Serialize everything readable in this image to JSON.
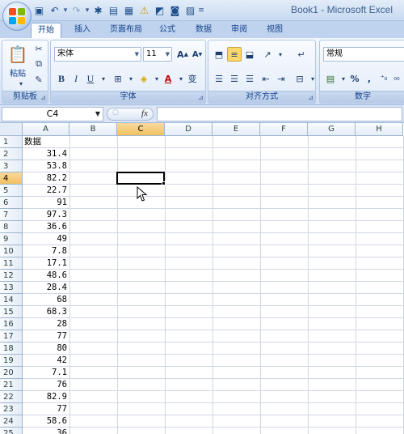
{
  "window": {
    "title": "Book1 - Microsoft Excel"
  },
  "quick_access": [
    "save-icon",
    "undo-icon",
    "redo-icon",
    "tool-icon",
    "form-icon",
    "grid-icon",
    "warning-icon",
    "chart-icon",
    "camera-icon",
    "image-icon"
  ],
  "ribbon_tabs": [
    "开始",
    "插入",
    "页面布局",
    "公式",
    "数据",
    "审阅",
    "视图"
  ],
  "active_tab": 0,
  "groups": {
    "clipboard": {
      "label": "剪贴板",
      "paste_label": "粘贴"
    },
    "font": {
      "label": "字体",
      "font_name": "宋体",
      "font_size": "11",
      "phonetic": "变"
    },
    "alignment": {
      "label": "对齐方式"
    },
    "number": {
      "label": "数字",
      "format": "常规",
      "percent": "%",
      "comma": ","
    }
  },
  "formula_bar": {
    "name_box": "C4",
    "fx": "fx",
    "formula": ""
  },
  "columns": [
    "A",
    "B",
    "C",
    "D",
    "E",
    "F",
    "G",
    "H"
  ],
  "active_column": "C",
  "active_row": 4,
  "rows": [
    {
      "r": "1",
      "a": "数据"
    },
    {
      "r": "2",
      "a": "31.4"
    },
    {
      "r": "3",
      "a": "53.8"
    },
    {
      "r": "4",
      "a": "82.2"
    },
    {
      "r": "5",
      "a": "22.7"
    },
    {
      "r": "6",
      "a": "91"
    },
    {
      "r": "7",
      "a": "97.3"
    },
    {
      "r": "8",
      "a": "36.6"
    },
    {
      "r": "9",
      "a": "49"
    },
    {
      "r": "10",
      "a": "7.8"
    },
    {
      "r": "11",
      "a": "17.1"
    },
    {
      "r": "12",
      "a": "48.6"
    },
    {
      "r": "13",
      "a": "28.4"
    },
    {
      "r": "14",
      "a": "68"
    },
    {
      "r": "15",
      "a": "68.3"
    },
    {
      "r": "16",
      "a": "28"
    },
    {
      "r": "17",
      "a": "77"
    },
    {
      "r": "18",
      "a": "80"
    },
    {
      "r": "19",
      "a": "42"
    },
    {
      "r": "20",
      "a": "7.1"
    },
    {
      "r": "21",
      "a": "76"
    },
    {
      "r": "22",
      "a": "82.9"
    },
    {
      "r": "23",
      "a": "77"
    },
    {
      "r": "24",
      "a": "58.6"
    },
    {
      "r": "25",
      "a": "36"
    }
  ],
  "colors": {
    "header_highlight": "#f1c15f",
    "ribbon_text": "#15428b",
    "gridline": "#d0d7e5"
  }
}
